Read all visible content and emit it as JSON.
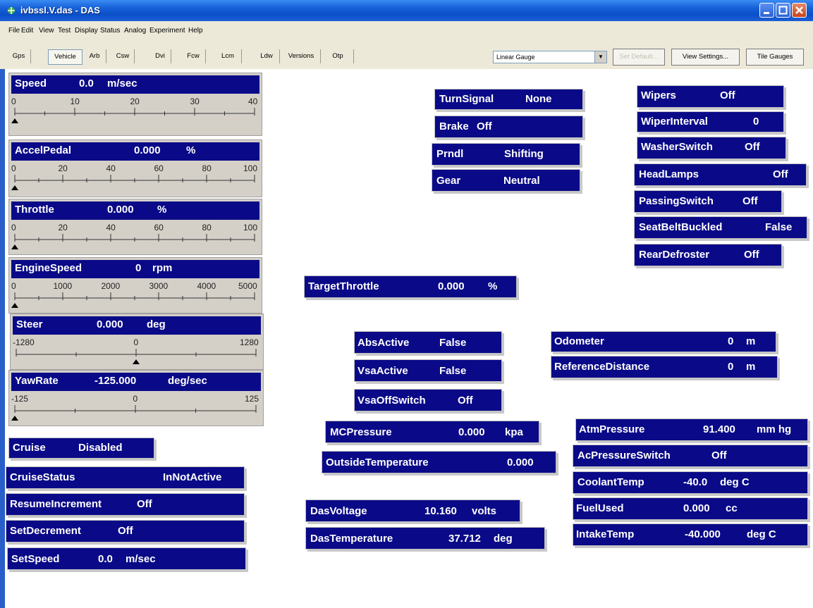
{
  "window": {
    "title": "ivbssl.V.das - DAS"
  },
  "menu": [
    "File",
    "Edit",
    "View",
    "Test",
    "Display",
    "Status",
    "Analog",
    "Experiment",
    "Help"
  ],
  "tabs": [
    "Gps",
    "Vehicle",
    "Arb",
    "Csw",
    "Dvi",
    "Fcw",
    "Lcm",
    "Ldw",
    "Versions",
    "Otp"
  ],
  "toolbar": {
    "gauge_type": "Linear Gauge",
    "set_default": "Set Default...",
    "view_settings": "View Settings...",
    "tile_gauges": "Tile Gauges"
  },
  "gauges": {
    "speed": {
      "label": "Speed",
      "value": "0.0",
      "unit": "m/sec",
      "ticks": [
        "0",
        "10",
        "20",
        "30",
        "40"
      ],
      "min": 0,
      "max": 40,
      "current": 0
    },
    "accel": {
      "label": "AccelPedal",
      "value": "0.000",
      "unit": "%",
      "ticks": [
        "0",
        "20",
        "40",
        "60",
        "80",
        "100"
      ],
      "min": 0,
      "max": 100,
      "current": 0
    },
    "throttle": {
      "label": "Throttle",
      "value": "0.000",
      "unit": "%",
      "ticks": [
        "0",
        "20",
        "40",
        "60",
        "80",
        "100"
      ],
      "min": 0,
      "max": 100,
      "current": 0
    },
    "engine": {
      "label": "EngineSpeed",
      "value": "0",
      "unit": "rpm",
      "ticks": [
        "0",
        "1000",
        "2000",
        "3000",
        "4000",
        "5000"
      ],
      "min": 0,
      "max": 5000,
      "current": 0
    },
    "steer": {
      "label": "Steer",
      "value": "0.000",
      "unit": "deg",
      "ticks": [
        "-1280",
        "0",
        "1280"
      ],
      "min": -1280,
      "max": 1280,
      "current": 0
    },
    "yaw": {
      "label": "YawRate",
      "value": "-125.000",
      "unit": "deg/sec",
      "ticks": [
        "-125",
        "0",
        "125"
      ],
      "min": -125,
      "max": 125,
      "current": -125
    }
  },
  "fields": {
    "cruise": {
      "name": "Cruise",
      "value": "Disabled"
    },
    "cruise_status": {
      "name": "CruiseStatus",
      "value": "InNotActive"
    },
    "resume_increment": {
      "name": "ResumeIncrement",
      "value": "Off"
    },
    "set_decrement": {
      "name": "SetDecrement",
      "value": "Off"
    },
    "set_speed": {
      "name": "SetSpeed",
      "value": "0.0",
      "unit": "m/sec"
    },
    "turn_signal": {
      "name": "TurnSignal",
      "value": "None"
    },
    "brake": {
      "name": "Brake",
      "value": "Off"
    },
    "prndl": {
      "name": "Prndl",
      "value": "Shifting"
    },
    "gear": {
      "name": "Gear",
      "value": "Neutral"
    },
    "wipers": {
      "name": "Wipers",
      "value": "Off"
    },
    "wiper_interval": {
      "name": "WiperInterval",
      "value": "0"
    },
    "washer_switch": {
      "name": "WasherSwitch",
      "value": "Off"
    },
    "head_lamps": {
      "name": "HeadLamps",
      "value": "Off"
    },
    "passing_switch": {
      "name": "PassingSwitch",
      "value": "Off"
    },
    "seat_belt": {
      "name": "SeatBeltBuckled",
      "value": "False"
    },
    "rear_defroster": {
      "name": "RearDefroster",
      "value": "Off"
    },
    "target_throttle": {
      "name": "TargetThrottle",
      "value": "0.000",
      "unit": "%"
    },
    "abs_active": {
      "name": "AbsActive",
      "value": "False"
    },
    "vsa_active": {
      "name": "VsaActive",
      "value": "False"
    },
    "vsa_off_switch": {
      "name": "VsaOffSwitch",
      "value": "Off"
    },
    "odometer": {
      "name": "Odometer",
      "value": "0",
      "unit": "m"
    },
    "reference_distance": {
      "name": "ReferenceDistance",
      "value": "0",
      "unit": "m"
    },
    "mc_pressure": {
      "name": "MCPressure",
      "value": "0.000",
      "unit": "kpa"
    },
    "outside_temp": {
      "name": "OutsideTemperature",
      "value": "0.000"
    },
    "atm_pressure": {
      "name": "AtmPressure",
      "value": "91.400",
      "unit": "mm hg"
    },
    "ac_pressure_switch": {
      "name": "AcPressureSwitch",
      "value": "Off"
    },
    "coolant_temp": {
      "name": "CoolantTemp",
      "value": "-40.0",
      "unit": "deg C"
    },
    "fuel_used": {
      "name": "FuelUsed",
      "value": "0.000",
      "unit": "cc"
    },
    "intake_temp": {
      "name": "IntakeTemp",
      "value": "-40.000",
      "unit": "deg C"
    },
    "das_voltage": {
      "name": "DasVoltage",
      "value": "10.160",
      "unit": "volts"
    },
    "das_temperature": {
      "name": "DasTemperature",
      "value": "37.712",
      "unit": "deg"
    }
  }
}
